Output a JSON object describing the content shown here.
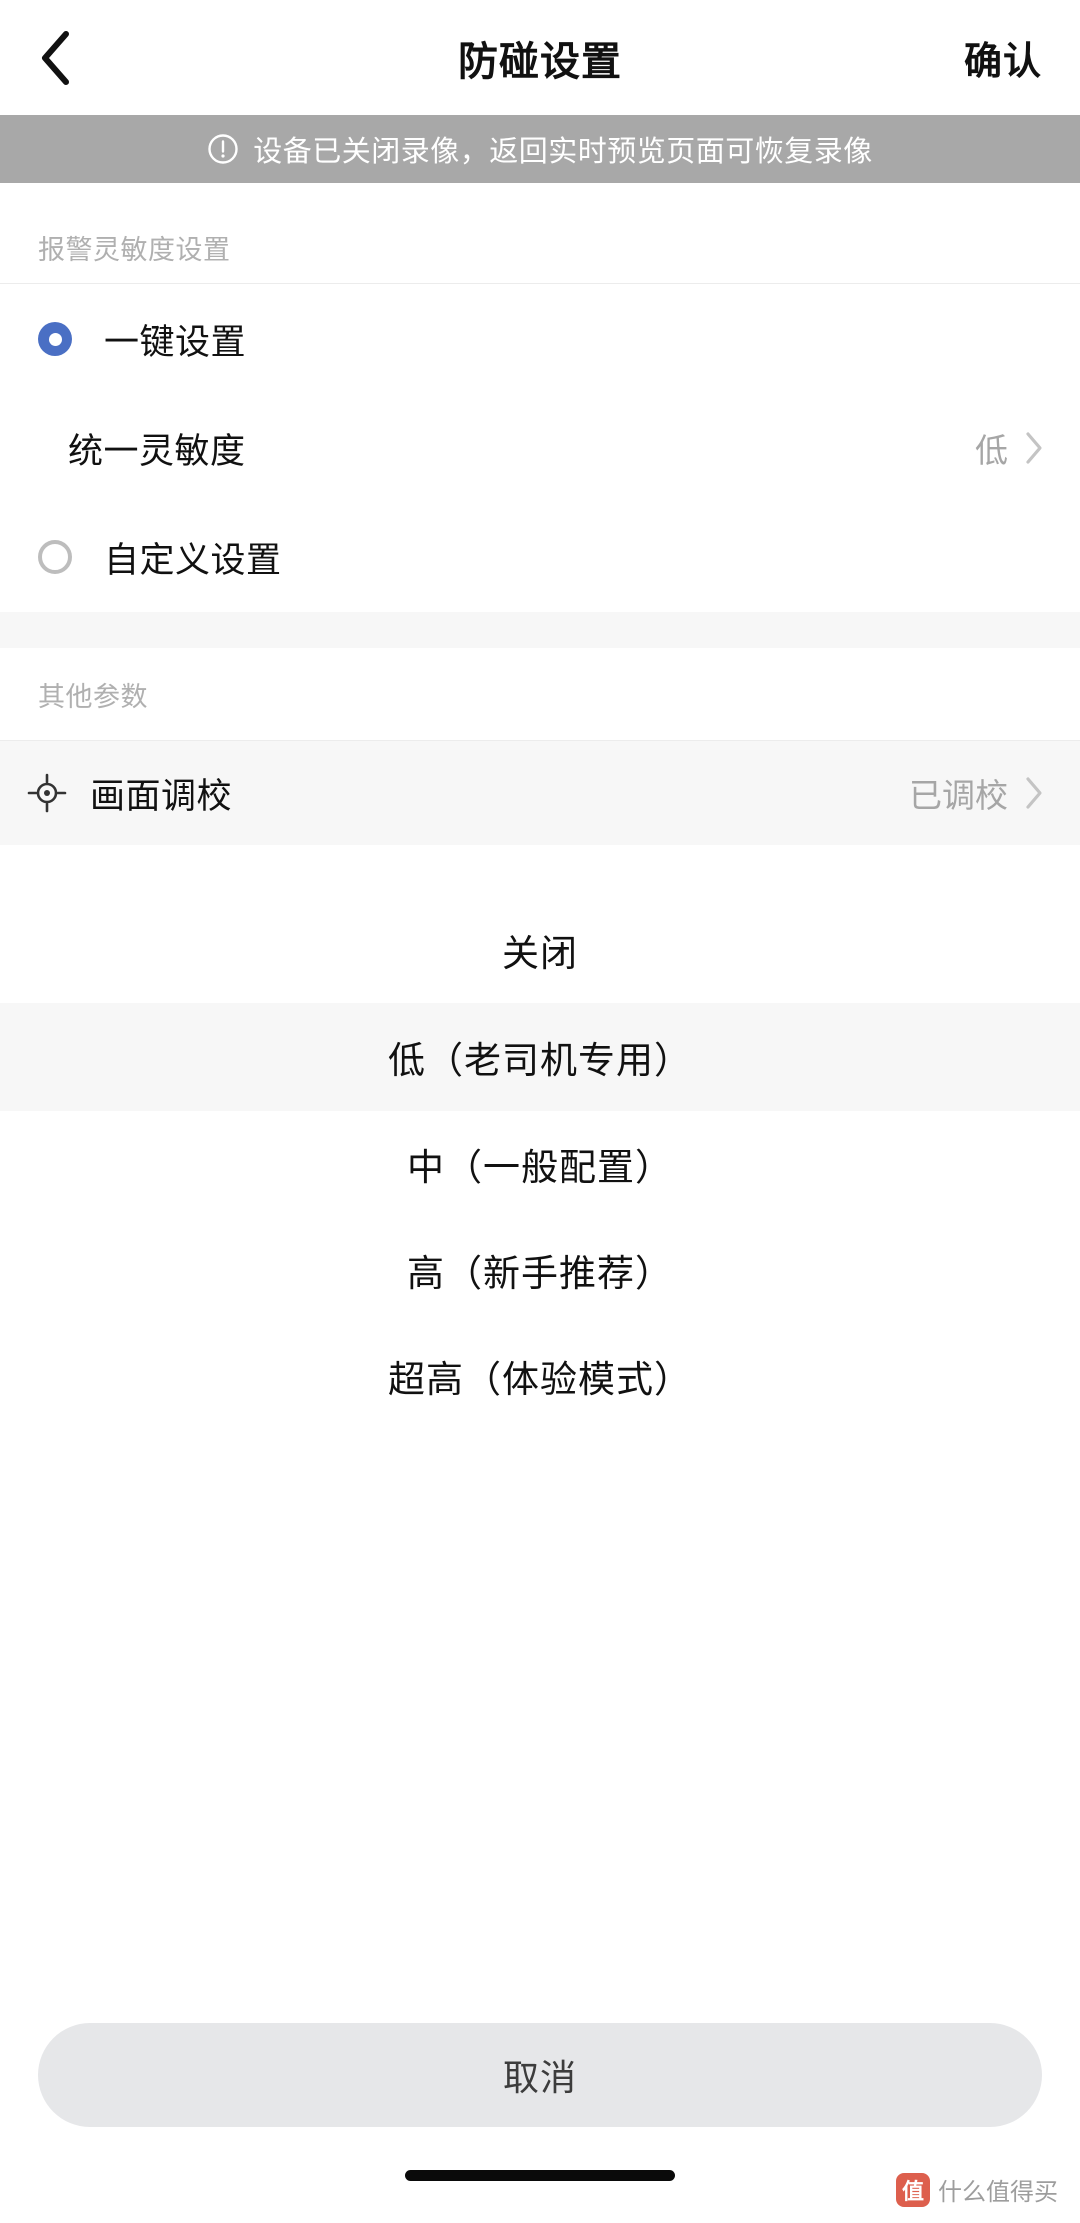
{
  "header": {
    "back_icon": "chevron-left-icon",
    "title": "防碰设置",
    "confirm_label": "确认"
  },
  "banner": {
    "icon": "exclamation-circle-icon",
    "text": "设备已关闭录像，返回实时预览页面可恢复录像",
    "background": "#a8a8a8",
    "text_color": "#ffffff"
  },
  "sections": [
    {
      "header": "报警灵敏度设置",
      "radio_one_key": {
        "label": "一键设置",
        "checked": true,
        "accent": "#4a6fc4"
      },
      "sub_row": {
        "label": "统一灵敏度",
        "value": "低",
        "chevron": "chevron-right-icon"
      },
      "radio_custom": {
        "label": "自定义设置",
        "checked": false
      }
    },
    {
      "header": "其他参数",
      "row": {
        "icon": "crosshair-icon",
        "label": "画面调校",
        "value": "已调校",
        "chevron": "chevron-right-icon"
      }
    }
  ],
  "action_sheet": {
    "options": [
      {
        "label": "关闭",
        "selected": false
      },
      {
        "label": "低（老司机专用）",
        "selected": true
      },
      {
        "label": "中（一般配置）",
        "selected": false
      },
      {
        "label": "高（新手推荐）",
        "selected": false
      },
      {
        "label": "超高（体验模式）",
        "selected": false
      }
    ],
    "cancel_label": "取消"
  },
  "watermark": {
    "badge": "值",
    "text": "什么值得买"
  }
}
